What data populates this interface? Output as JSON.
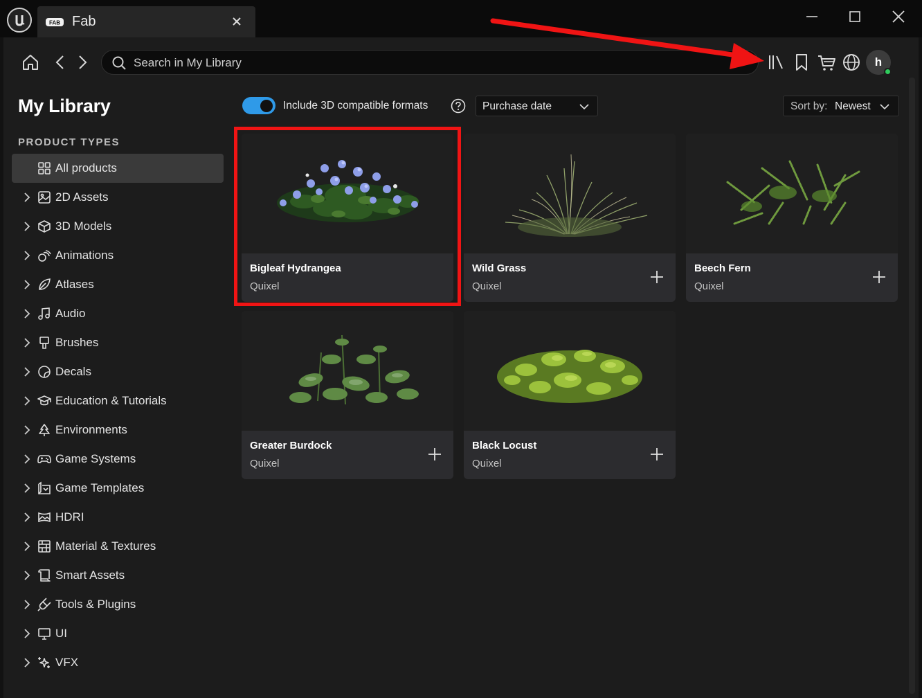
{
  "window": {
    "tab_title": "Fab",
    "tab_logo_text": "FAB"
  },
  "toolbar": {
    "search_placeholder": "Search in My Library",
    "avatar_initial": "h"
  },
  "sidebar": {
    "title": "My Library",
    "section_title": "PRODUCT TYPES",
    "items": [
      {
        "label": "All products",
        "icon": "grid-icon",
        "active": true
      },
      {
        "label": "2D Assets",
        "icon": "image-icon"
      },
      {
        "label": "3D Models",
        "icon": "cube-icon"
      },
      {
        "label": "Animations",
        "icon": "animation-icon"
      },
      {
        "label": "Atlases",
        "icon": "leaf-icon"
      },
      {
        "label": "Audio",
        "icon": "music-note-icon"
      },
      {
        "label": "Brushes",
        "icon": "brush-icon"
      },
      {
        "label": "Decals",
        "icon": "decal-icon"
      },
      {
        "label": "Education & Tutorials",
        "icon": "graduation-cap-icon"
      },
      {
        "label": "Environments",
        "icon": "tree-icon"
      },
      {
        "label": "Game Systems",
        "icon": "gamepad-icon"
      },
      {
        "label": "Game Templates",
        "icon": "template-icon"
      },
      {
        "label": "HDRI",
        "icon": "hdri-icon"
      },
      {
        "label": "Material & Textures",
        "icon": "texture-icon"
      },
      {
        "label": "Smart Assets",
        "icon": "scroll-icon"
      },
      {
        "label": "Tools & Plugins",
        "icon": "plug-icon"
      },
      {
        "label": "UI",
        "icon": "monitor-icon"
      },
      {
        "label": "VFX",
        "icon": "sparkles-icon"
      }
    ]
  },
  "filters": {
    "toggle_label": "Include 3D compatible formats",
    "toggle_on": true,
    "date_filter": "Purchase date",
    "sort_prefix": "Sort by:",
    "sort_value": "Newest"
  },
  "products": [
    {
      "title": "Bigleaf Hydrangea",
      "publisher": "Quixel",
      "selected": true
    },
    {
      "title": "Wild Grass",
      "publisher": "Quixel"
    },
    {
      "title": "Beech Fern",
      "publisher": "Quixel"
    },
    {
      "title": "Greater Burdock",
      "publisher": "Quixel"
    },
    {
      "title": "Black Locust",
      "publisher": "Quixel"
    }
  ],
  "colors": {
    "toggle_accent": "#2f9ae8",
    "highlight_box": "#f01414",
    "annotation_arrow": "#f01414",
    "online_status": "#2fcc5c"
  }
}
